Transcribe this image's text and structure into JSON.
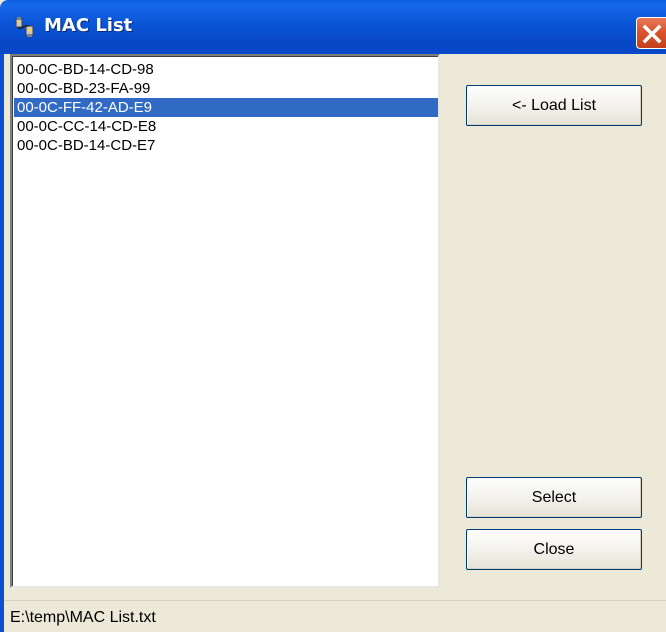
{
  "window": {
    "title": "MAC List"
  },
  "mac_list": {
    "items": [
      {
        "label": "00-0C-BD-14-CD-98",
        "selected": false
      },
      {
        "label": "00-0C-BD-23-FA-99",
        "selected": false
      },
      {
        "label": "00-0C-FF-42-AD-E9",
        "selected": true
      },
      {
        "label": "00-0C-CC-14-CD-E8",
        "selected": false
      },
      {
        "label": "00-0C-BD-14-CD-E7",
        "selected": false
      }
    ]
  },
  "buttons": {
    "load_list": "<- Load List",
    "select": "Select",
    "close": "Close"
  },
  "status": {
    "path": "E:\\temp\\MAC List.txt"
  },
  "icons": {
    "app": "network-cable-icon",
    "close": "close-icon"
  },
  "colors": {
    "titlebar": "#0b57d8",
    "selection": "#316ac5",
    "close_button": "#d9542f",
    "window_bg": "#ece9d8"
  }
}
